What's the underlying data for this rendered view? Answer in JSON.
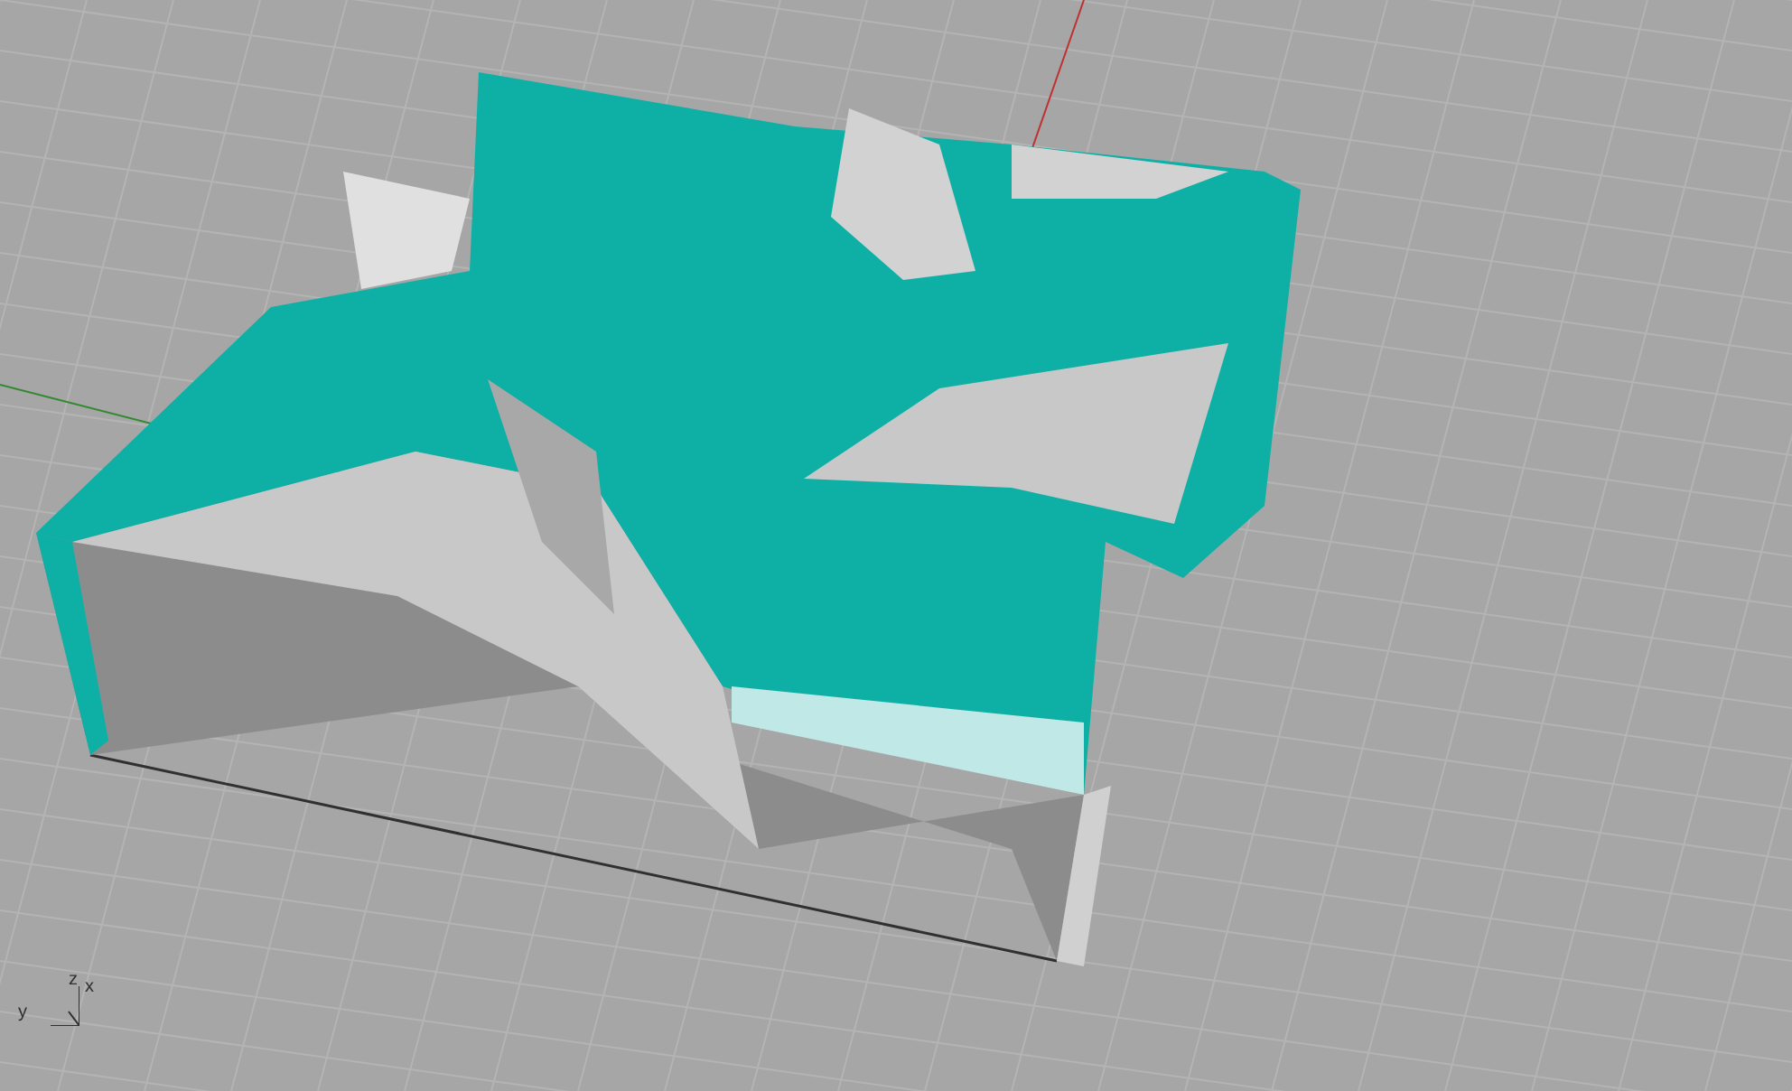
{
  "viewport": {
    "axes_widget": {
      "labels": [
        "z",
        "x",
        "y"
      ]
    }
  }
}
